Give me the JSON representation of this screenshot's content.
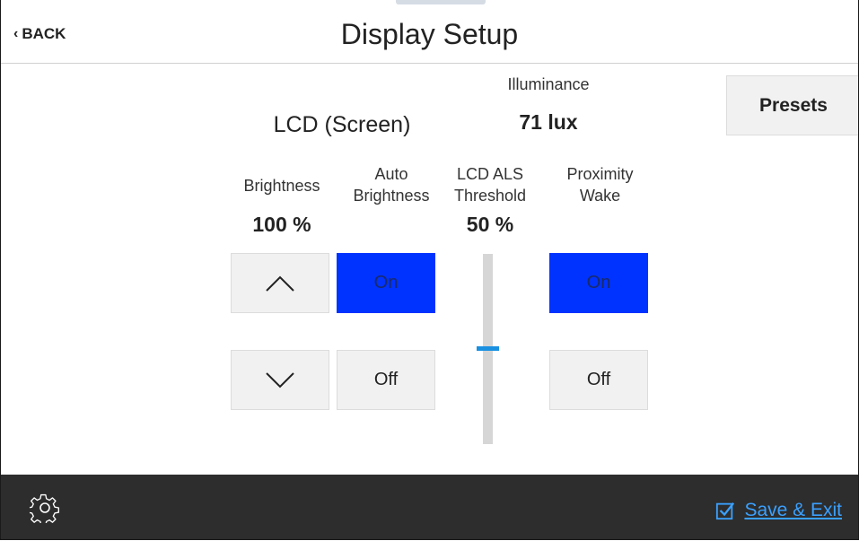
{
  "header": {
    "back_label": "BACK",
    "title": "Display Setup"
  },
  "lcd_label": "LCD (Screen)",
  "illuminance": {
    "label": "Illuminance",
    "value": "71 lux"
  },
  "presets_label": "Presets",
  "brightness": {
    "label": "Brightness",
    "value": "100 %"
  },
  "auto_brightness": {
    "label_line1": "Auto",
    "label_line2": "Brightness",
    "on_label": "On",
    "off_label": "Off",
    "selected": "On"
  },
  "lcd_als": {
    "label_line1": "LCD ALS",
    "label_line2": "Threshold",
    "value": "50 %",
    "level": 0.5
  },
  "proximity_wake": {
    "label_line1": "Proximity",
    "label_line2": "Wake",
    "on_label": "On",
    "off_label": "Off",
    "selected": "On"
  },
  "footer": {
    "save_label": "Save & Exit",
    "settings_icon": "gear-icon",
    "save_icon": "checkbox-icon"
  },
  "colors": {
    "selected_button": "#0033ff",
    "footer_bg": "#2d2d2d",
    "link": "#3aa0ff",
    "slider_thumb": "#1a90e0"
  }
}
